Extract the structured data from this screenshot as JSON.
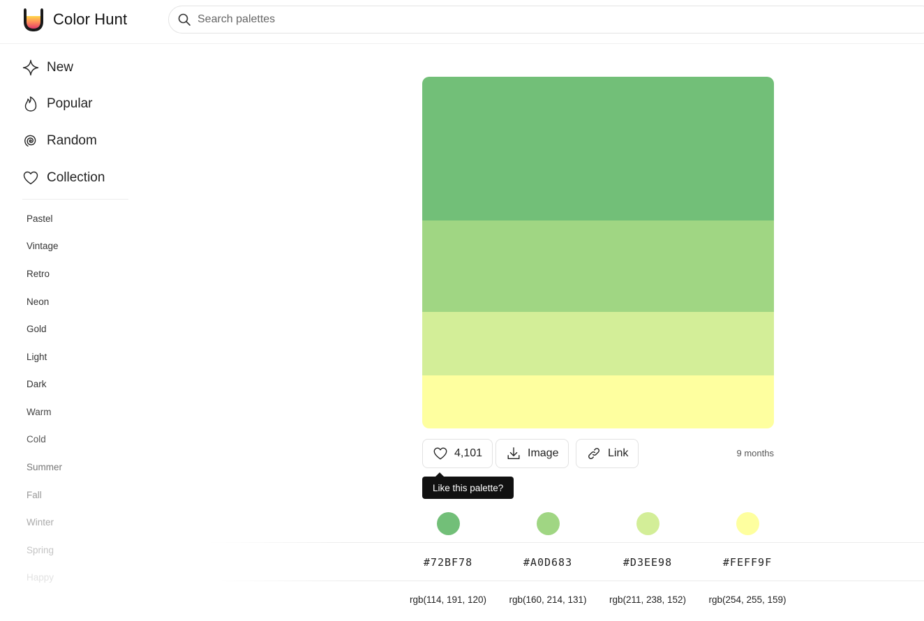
{
  "header": {
    "app_name": "Color Hunt",
    "search_placeholder": "Search palettes"
  },
  "sidebar": {
    "nav": [
      {
        "label": "New",
        "icon": "sparkle-icon"
      },
      {
        "label": "Popular",
        "icon": "flame-icon"
      },
      {
        "label": "Random",
        "icon": "spiral-icon"
      },
      {
        "label": "Collection",
        "icon": "heart-icon"
      }
    ],
    "tags": [
      "Pastel",
      "Vintage",
      "Retro",
      "Neon",
      "Gold",
      "Light",
      "Dark",
      "Warm",
      "Cold",
      "Summer",
      "Fall",
      "Winter",
      "Spring",
      "Happy"
    ]
  },
  "palette": {
    "colors": [
      "#72BF78",
      "#A0D683",
      "#D3EE98",
      "#FEFF9F"
    ],
    "hex": [
      "#72BF78",
      "#A0D683",
      "#D3EE98",
      "#FEFF9F"
    ],
    "rgb": [
      "rgb(114, 191, 120)",
      "rgb(160, 214, 131)",
      "rgb(211, 238, 152)",
      "rgb(254, 255, 159)"
    ]
  },
  "actions": {
    "likes": "4,101",
    "image_label": "Image",
    "link_label": "Link",
    "age": "9 months",
    "tooltip": "Like this palette?"
  }
}
